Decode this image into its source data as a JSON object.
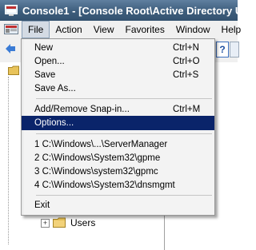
{
  "window": {
    "title": "Console1 - [Console Root\\Active Directory Users"
  },
  "menubar": {
    "items": [
      "File",
      "Action",
      "View",
      "Favorites",
      "Window",
      "Help"
    ]
  },
  "file_menu": {
    "new": {
      "label": "New",
      "shortcut": "Ctrl+N"
    },
    "open": {
      "label": "Open...",
      "shortcut": "Ctrl+O"
    },
    "save": {
      "label": "Save",
      "shortcut": "Ctrl+S"
    },
    "save_as": {
      "label": "Save As..."
    },
    "add_remove_snapin": {
      "label": "Add/Remove Snap-in...",
      "shortcut": "Ctrl+M"
    },
    "options": {
      "label": "Options..."
    },
    "recent": [
      "1 C:\\Windows\\...\\ServerManager",
      "2 C:\\Windows\\System32\\gpme",
      "3 C:\\Windows\\system32\\gpmc",
      "4 C:\\Windows\\System32\\dnsmgmt"
    ],
    "exit": {
      "label": "Exit"
    }
  },
  "tree": {
    "expander": "+",
    "users_label": "Users"
  },
  "toolbar": {
    "help_glyph": "?"
  },
  "colors": {
    "titlebar": "#3d5d7c",
    "highlight": "#0a246a",
    "folder": "#e8c35a"
  }
}
